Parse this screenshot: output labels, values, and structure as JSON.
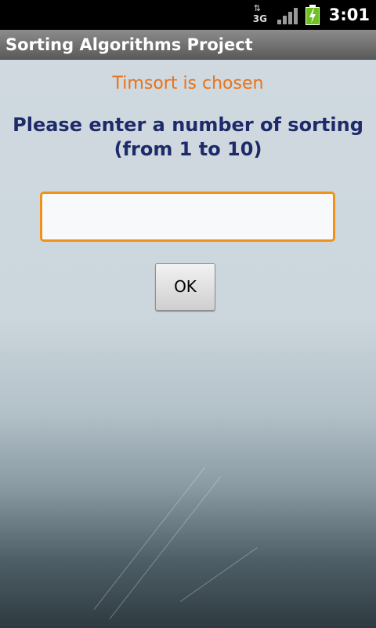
{
  "status_bar": {
    "network_label": "3G",
    "network_arrows": "⇅",
    "network_icon": "network-3g-icon",
    "signal_icon": "signal-strength-icon",
    "battery_icon": "battery-charging-icon",
    "time": "3:01"
  },
  "app": {
    "title": "Sorting Algorithms Project"
  },
  "main": {
    "status_message": "Timsort is chosen",
    "prompt": "Please enter a number of sorting (from 1 to 10)",
    "number_input": {
      "value": "",
      "placeholder": ""
    },
    "ok_label": "OK"
  },
  "colors": {
    "status_message": "#e8731a",
    "prompt": "#1e2a6a",
    "input_border": "#f29117",
    "title_bar": "#6f6f6f",
    "battery": "#6cc020"
  }
}
